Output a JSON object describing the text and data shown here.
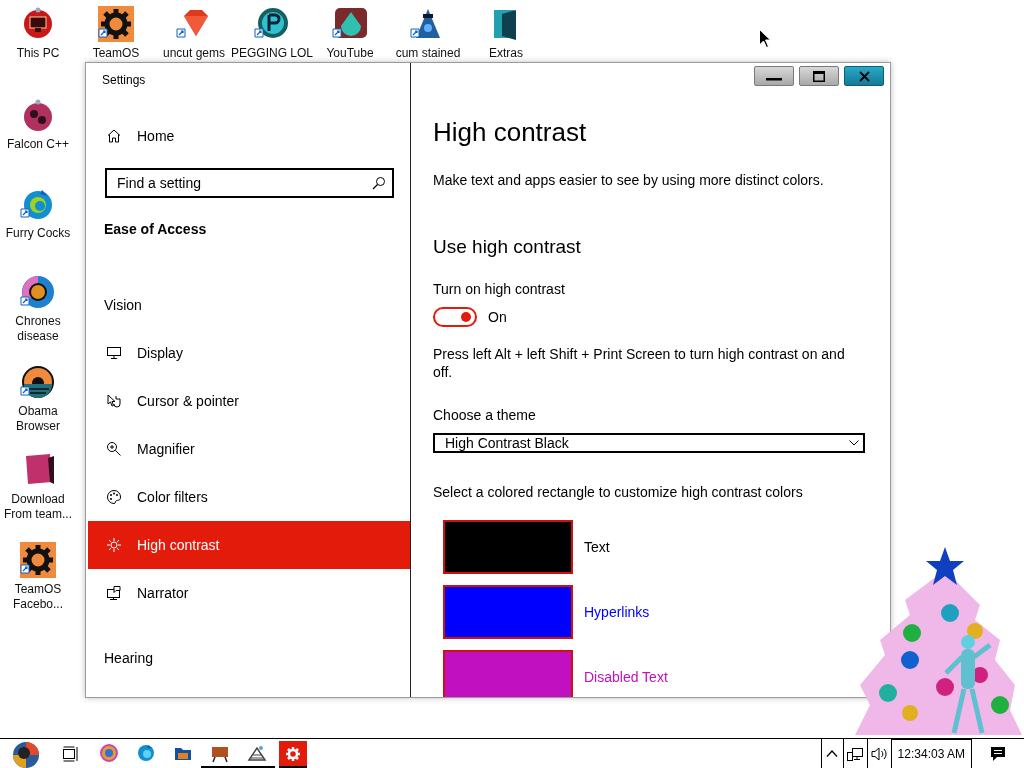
{
  "desktop_icons": [
    {
      "label": "This PC"
    },
    {
      "label": "TeamOS"
    },
    {
      "label": "uncut gems"
    },
    {
      "label": "PEGGING LOL"
    },
    {
      "label": "YouTube"
    },
    {
      "label": "cum stained"
    },
    {
      "label": "Extras"
    },
    {
      "label": "Falcon C++"
    },
    {
      "label": "Furry Cocks"
    },
    {
      "label": "Chrones disease"
    },
    {
      "label": "Obama Browser"
    },
    {
      "label": "Download From team..."
    },
    {
      "label": "TeamOS Facebo..."
    }
  ],
  "window": {
    "title": "Settings",
    "sidebar": {
      "home": "Home",
      "search": {
        "placeholder": "Find a setting"
      },
      "section": "Ease of Access",
      "groups": [
        {
          "heading": "Vision",
          "items": [
            {
              "label": "Display",
              "selected": false
            },
            {
              "label": "Cursor & pointer",
              "selected": false
            },
            {
              "label": "Magnifier",
              "selected": false
            },
            {
              "label": "Color filters",
              "selected": false
            },
            {
              "label": "High contrast",
              "selected": true
            },
            {
              "label": "Narrator",
              "selected": false
            }
          ]
        },
        {
          "heading": "Hearing"
        }
      ]
    },
    "content": {
      "title": "High contrast",
      "description": "Make text and apps easier to see by using more distinct colors.",
      "section_title": "Use high contrast",
      "toggle": {
        "label": "Turn on high contrast",
        "on": true,
        "state_text": "On"
      },
      "shortcut_note": "Press left Alt + left Shift + Print Screen to turn high contrast on and off.",
      "theme": {
        "label": "Choose a theme",
        "value": "High Contrast Black"
      },
      "swatch_prompt": "Select a colored rectangle to customize high contrast colors",
      "swatches": [
        {
          "label": "Text",
          "color": "#000000"
        },
        {
          "label": "Hyperlinks",
          "color": "#0000ff"
        },
        {
          "label": "Disabled Text",
          "color": "#c010c0"
        }
      ]
    }
  },
  "taskbar": {
    "apps": [
      {
        "running": false,
        "selected": false
      },
      {
        "running": false,
        "selected": false
      },
      {
        "running": false,
        "selected": false
      },
      {
        "running": true,
        "selected": false
      },
      {
        "running": true,
        "selected": false
      },
      {
        "running": true,
        "selected": true
      }
    ],
    "clock": "12:34:03 AM"
  }
}
